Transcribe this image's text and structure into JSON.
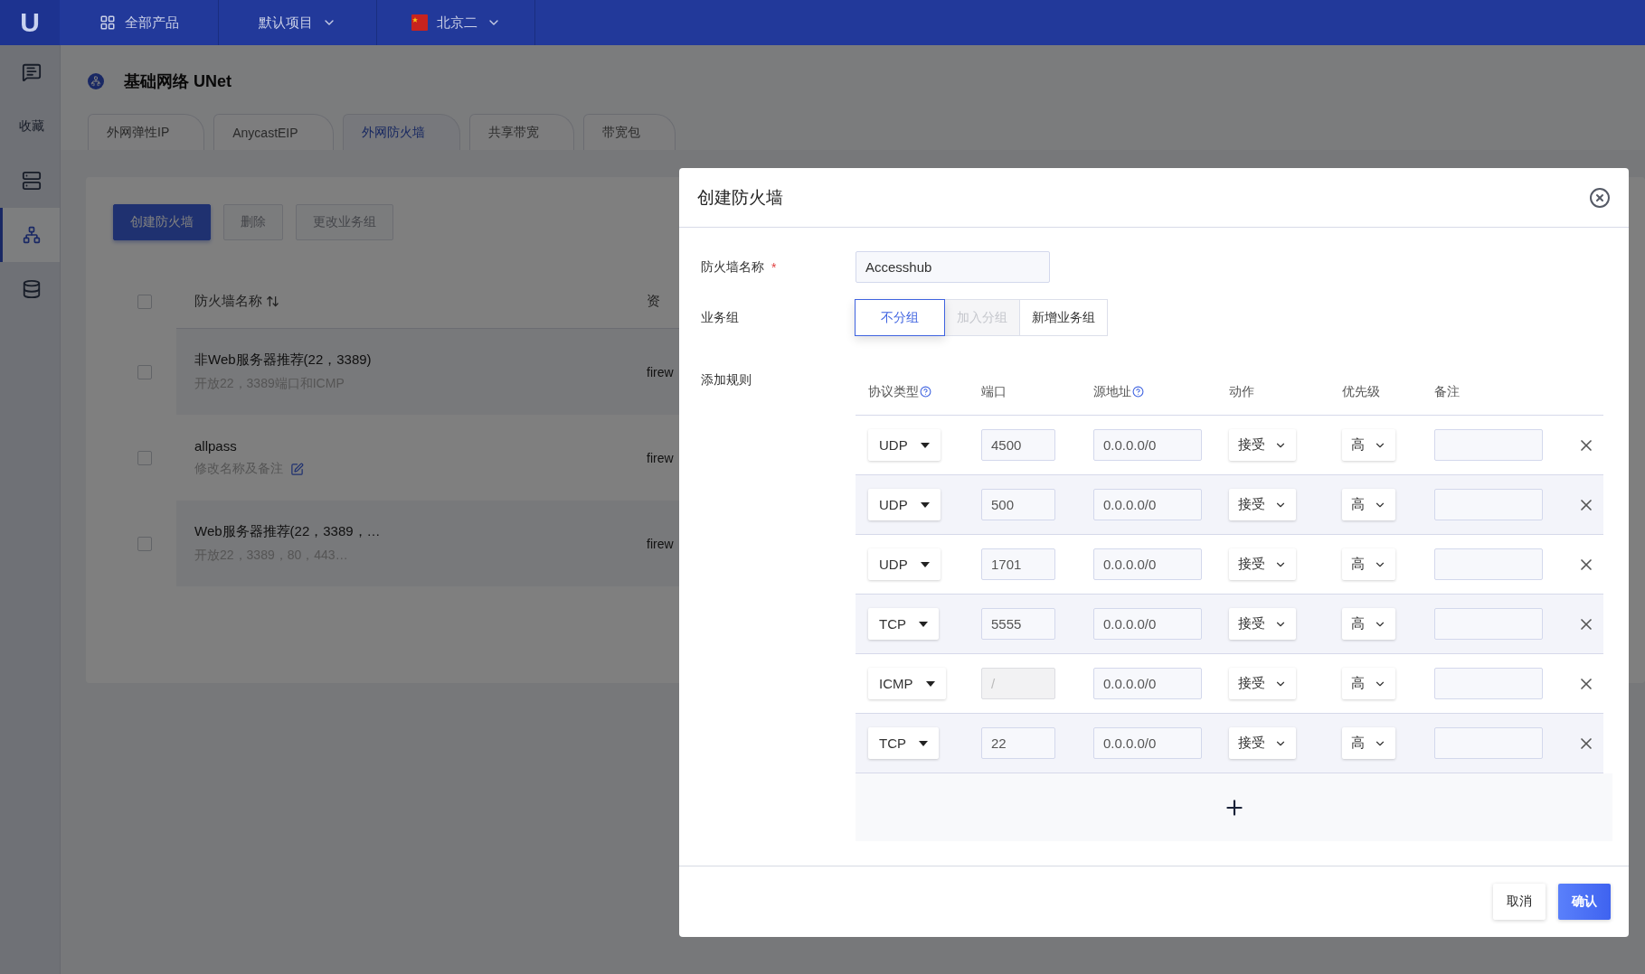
{
  "topbar": {
    "logo": "U",
    "nav": [
      {
        "label": "全部产品",
        "kind": "products"
      },
      {
        "label": "默认项目",
        "kind": "dropdown"
      },
      {
        "label": "北京二",
        "kind": "region"
      }
    ]
  },
  "sidebar": {
    "items": [
      {
        "kind": "icon",
        "selected": false
      },
      {
        "kind": "label",
        "label": "收藏",
        "selected": false
      },
      {
        "kind": "icon",
        "selected": false
      },
      {
        "kind": "icon",
        "selected": true
      },
      {
        "kind": "icon",
        "selected": false
      }
    ]
  },
  "page": {
    "title": "基础网络 UNet",
    "tabs": [
      {
        "label": "外网弹性IP",
        "selected": false
      },
      {
        "label": "AnycastEIP",
        "selected": false
      },
      {
        "label": "外网防火墙",
        "selected": true
      },
      {
        "label": "共享带宽",
        "selected": false
      },
      {
        "label": "带宽包",
        "selected": false
      }
    ],
    "toolbar": [
      {
        "label": "创建防火墙",
        "kind": "primary",
        "disabled": false
      },
      {
        "label": "删除",
        "kind": "default",
        "disabled": true
      },
      {
        "label": "更改业务组",
        "kind": "default",
        "disabled": true
      }
    ],
    "table": {
      "all_checked": false,
      "columns": [
        {
          "label": "防火墙名称",
          "sortable": true
        },
        {
          "label": "资",
          "sortable": false
        }
      ],
      "rows": [
        {
          "checked": false,
          "name": "非Web服务器推荐(22，3389)",
          "description": "开放22，3389端口和ICMP",
          "editable": false,
          "column_2": "firew"
        },
        {
          "checked": false,
          "name": "allpass",
          "description": "修改名称及备注",
          "editable": true,
          "column_2": "firew"
        },
        {
          "checked": false,
          "name": "Web服务器推荐(22，3389，…",
          "description": "开放22，3389，80，443…",
          "editable": false,
          "column_2": "firew"
        }
      ]
    }
  },
  "dialog": {
    "title": "创建防火墙",
    "name_field": {
      "label": "防火墙名称",
      "required_mark": "*",
      "value": "Accesshub"
    },
    "group_field": {
      "label": "业务组",
      "options": [
        {
          "label": "不分组",
          "selected": true,
          "disabled": false
        },
        {
          "label": "加入分组",
          "selected": false,
          "disabled": true
        },
        {
          "label": "新增业务组",
          "selected": false,
          "disabled": false
        }
      ]
    },
    "rules": {
      "label": "添加规则",
      "columns": [
        {
          "label": "协议类型",
          "help": true
        },
        {
          "label": "端口",
          "help": false
        },
        {
          "label": "源地址",
          "help": true
        },
        {
          "label": "动作",
          "help": false
        },
        {
          "label": "优先级",
          "help": false
        },
        {
          "label": "备注",
          "help": false
        }
      ],
      "rows": [
        {
          "protocol": "UDP",
          "port": "4500",
          "port_disabled": false,
          "source": "0.0.0.0/0",
          "action": "接受",
          "priority": "高"
        },
        {
          "protocol": "UDP",
          "port": "500",
          "port_disabled": false,
          "source": "0.0.0.0/0",
          "action": "接受",
          "priority": "高"
        },
        {
          "protocol": "UDP",
          "port": "1701",
          "port_disabled": false,
          "source": "0.0.0.0/0",
          "action": "接受",
          "priority": "高"
        },
        {
          "protocol": "TCP",
          "port": "5555",
          "port_disabled": false,
          "source": "0.0.0.0/0",
          "action": "接受",
          "priority": "高"
        },
        {
          "protocol": "ICMP",
          "port": "/",
          "port_disabled": true,
          "source": "0.0.0.0/0",
          "action": "接受",
          "priority": "高"
        },
        {
          "protocol": "TCP",
          "port": "22",
          "port_disabled": false,
          "source": "0.0.0.0/0",
          "action": "接受",
          "priority": "高"
        }
      ]
    },
    "buttons": [
      {
        "label": "取消",
        "kind": "default"
      },
      {
        "label": "确认",
        "kind": "primary"
      }
    ]
  }
}
